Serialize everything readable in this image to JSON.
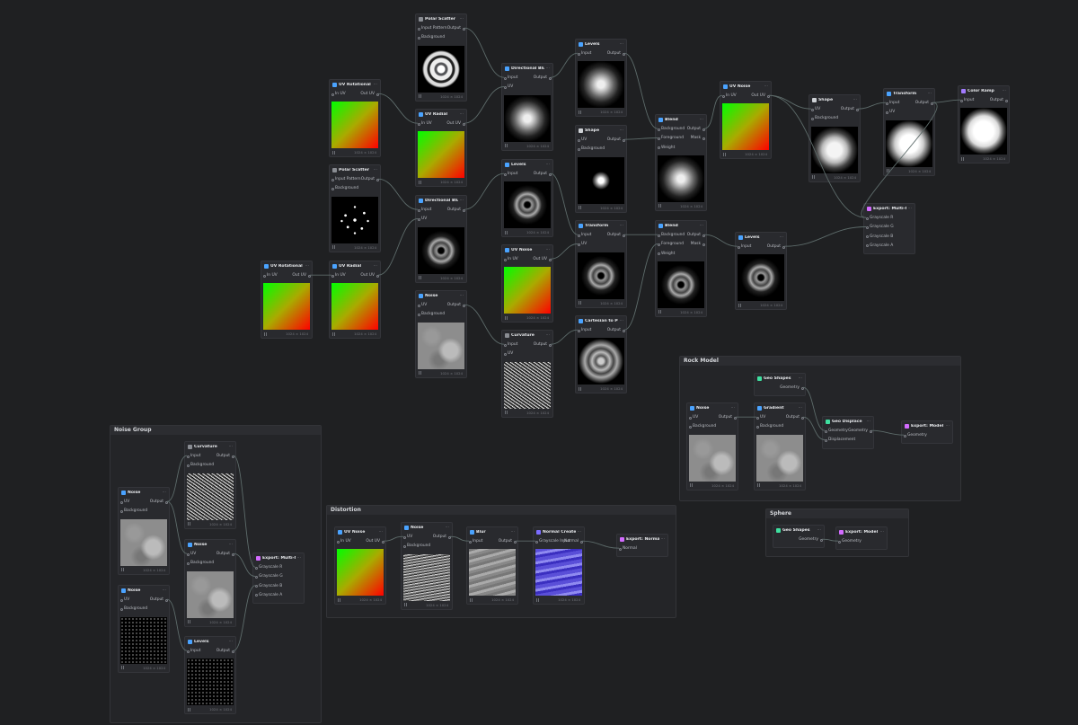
{
  "groups": [
    {
      "key": "noise_group",
      "title": "Noise Group"
    },
    {
      "key": "distortion",
      "title": "Distortion"
    },
    {
      "key": "rock_model",
      "title": "Rock Model"
    },
    {
      "key": "sphere",
      "title": "Sphere"
    }
  ],
  "nodes": [
    {
      "key": "polar_scatter_1",
      "title": "Polar Scatter",
      "icon_color": "#8a8d93",
      "inputs": [
        "Input Pattern",
        "Background"
      ],
      "outputs": [
        "Output"
      ],
      "preview": "pv-radial",
      "res": "1024 × 1024"
    },
    {
      "key": "uv_rotational_1",
      "title": "UV Rotational",
      "icon_color": "#4aa3ff",
      "inputs": [
        "In UV"
      ],
      "outputs": [
        "Out UV"
      ],
      "preview": "pv-uv2",
      "res": "1024 × 1024"
    },
    {
      "key": "uv_radial_1",
      "title": "UV Radial",
      "icon_color": "#4aa3ff",
      "inputs": [
        "In UV"
      ],
      "outputs": [
        "Out UV"
      ],
      "preview": "pv-uv2",
      "res": "1024 × 1024"
    },
    {
      "key": "directional_blur_1",
      "title": "Directional Blur",
      "icon_color": "#4aa3ff",
      "inputs": [
        "Input",
        "UV"
      ],
      "outputs": [
        "Output"
      ],
      "preview": "pv-swirl-soft",
      "res": "1024 × 1024"
    },
    {
      "key": "levels_1",
      "title": "Levels",
      "icon_color": "#4aa3ff",
      "inputs": [
        "Input"
      ],
      "outputs": [
        "Output"
      ],
      "preview": "pv-swirl-soft",
      "res": "1024 × 1024"
    },
    {
      "key": "shape_1",
      "title": "Shape",
      "icon_color": "#cfd2d6",
      "inputs": [
        "UV",
        "Background"
      ],
      "outputs": [
        "Output"
      ],
      "preview": "pv-dot",
      "res": "1024 × 1024"
    },
    {
      "key": "blend_1",
      "title": "Blend",
      "icon_color": "#4aa3ff",
      "inputs": [
        "Background",
        "Foreground",
        "Weight"
      ],
      "outputs": [
        "Output",
        "Mask"
      ],
      "preview": "pv-swirl-soft",
      "res": "1024 × 1024"
    },
    {
      "key": "uv_noise_1",
      "title": "UV Noise",
      "icon_color": "#4aa3ff",
      "inputs": [
        "In UV"
      ],
      "outputs": [
        "Out UV"
      ],
      "preview": "pv-uv2",
      "res": "1024 × 1024"
    },
    {
      "key": "shape_2",
      "title": "Shape",
      "icon_color": "#cfd2d6",
      "inputs": [
        "UV",
        "Background"
      ],
      "outputs": [
        "Output"
      ],
      "preview": "pv-blob",
      "res": "1024 × 1024"
    },
    {
      "key": "transform_1",
      "title": "Transform",
      "icon_color": "#4aa3ff",
      "inputs": [
        "Input",
        "UV"
      ],
      "outputs": [
        "Output"
      ],
      "preview": "pv-cloud",
      "res": "1024 × 1024"
    },
    {
      "key": "color_ramp",
      "title": "Color Ramp",
      "icon_color": "#a27bff",
      "inputs": [
        "Input"
      ],
      "outputs": [
        "Output"
      ],
      "preview": "pv-ramp",
      "res": "1024 × 1024"
    },
    {
      "key": "polar_scatter_2",
      "title": "Polar Scatter",
      "icon_color": "#8a8d93",
      "inputs": [
        "Input Pattern",
        "Background"
      ],
      "outputs": [
        "Output"
      ],
      "preview": "pv-sparks",
      "res": "1024 × 1024"
    },
    {
      "key": "directional_blur_2",
      "title": "Directional Blur",
      "icon_color": "#4aa3ff",
      "inputs": [
        "Input",
        "UV"
      ],
      "outputs": [
        "Output"
      ],
      "preview": "pv-swirl",
      "res": "1024 × 1024"
    },
    {
      "key": "levels_2",
      "title": "Levels",
      "icon_color": "#4aa3ff",
      "inputs": [
        "Input"
      ],
      "outputs": [
        "Output"
      ],
      "preview": "pv-swirl",
      "res": "1024 × 1024"
    },
    {
      "key": "transform_2",
      "title": "Transform",
      "icon_color": "#4aa3ff",
      "inputs": [
        "Input",
        "UV"
      ],
      "outputs": [
        "Output"
      ],
      "preview": "pv-swirl",
      "res": "1024 × 1024"
    },
    {
      "key": "blend_2",
      "title": "Blend",
      "icon_color": "#4aa3ff",
      "inputs": [
        "Background",
        "Foreground",
        "Weight"
      ],
      "outputs": [
        "Output",
        "Mask"
      ],
      "preview": "pv-swirl",
      "res": "1024 × 1024"
    },
    {
      "key": "levels_3",
      "title": "Levels",
      "icon_color": "#4aa3ff",
      "inputs": [
        "Input"
      ],
      "outputs": [
        "Output"
      ],
      "preview": "pv-swirl",
      "res": "1024 × 1024"
    },
    {
      "key": "export_multi_mask_1",
      "title": "Export: Multi-Mask",
      "icon_color": "#d36bff",
      "inputs": [
        "Grayscale R",
        "Grayscale G",
        "Grayscale B",
        "Grayscale A"
      ],
      "outputs": [],
      "preview": null
    },
    {
      "key": "uv_rotational_2",
      "title": "UV Rotational",
      "icon_color": "#4aa3ff",
      "inputs": [
        "In UV"
      ],
      "outputs": [
        "Out UV"
      ],
      "preview": "pv-uv2",
      "res": "1024 × 1024"
    },
    {
      "key": "uv_radial_2",
      "title": "UV Radial",
      "icon_color": "#4aa3ff",
      "inputs": [
        "In UV"
      ],
      "outputs": [
        "Out UV"
      ],
      "preview": "pv-uv2",
      "res": "1024 × 1024"
    },
    {
      "key": "uv_noise_2",
      "title": "UV Noise",
      "icon_color": "#4aa3ff",
      "inputs": [
        "In UV"
      ],
      "outputs": [
        "Out UV"
      ],
      "preview": "pv-uv2",
      "res": "1024 × 1024"
    },
    {
      "key": "noise_1",
      "title": "Noise",
      "icon_color": "#4aa3ff",
      "inputs": [
        "UV",
        "Background"
      ],
      "outputs": [
        "Output"
      ],
      "preview": "pv-noise",
      "res": "1024 × 1024"
    },
    {
      "key": "curvature_1",
      "title": "Curvature",
      "icon_color": "#8a8d93",
      "inputs": [
        "Input",
        "UV"
      ],
      "outputs": [
        "Output"
      ],
      "preview": "pv-curv",
      "res": "1024 × 1024"
    },
    {
      "key": "cartesian_polar",
      "title": "Cartesian to Polar",
      "icon_color": "#4aa3ff",
      "inputs": [
        "Input"
      ],
      "outputs": [
        "Output"
      ],
      "preview": "pv-polar",
      "res": "1024 × 1024"
    },
    {
      "key": "ng_noise_1",
      "title": "Noise",
      "icon_color": "#4aa3ff",
      "inputs": [
        "UV",
        "Background"
      ],
      "outputs": [
        "Output"
      ],
      "preview": "pv-noise",
      "res": "1024 × 1024"
    },
    {
      "key": "ng_curvature",
      "title": "Curvature",
      "icon_color": "#8a8d93",
      "inputs": [
        "Input",
        "Background"
      ],
      "outputs": [
        "Output"
      ],
      "preview": "pv-curv",
      "res": "1024 × 1024"
    },
    {
      "key": "ng_noise_2",
      "title": "Noise",
      "icon_color": "#4aa3ff",
      "inputs": [
        "UV",
        "Background"
      ],
      "outputs": [
        "Output"
      ],
      "preview": "pv-noise",
      "res": "1024 × 1024"
    },
    {
      "key": "ng_export",
      "title": "Export: Multi-Mask",
      "icon_color": "#d36bff",
      "inputs": [
        "Grayscale R",
        "Grayscale G",
        "Grayscale B",
        "Grayscale A"
      ],
      "outputs": [],
      "preview": null
    },
    {
      "key": "ng_noise_3",
      "title": "Noise",
      "icon_color": "#4aa3ff",
      "inputs": [
        "UV",
        "Background"
      ],
      "outputs": [
        "Output"
      ],
      "preview": "pv-dots",
      "res": "1024 × 1024"
    },
    {
      "key": "ng_levels",
      "title": "Levels",
      "icon_color": "#4aa3ff",
      "inputs": [
        "Input"
      ],
      "outputs": [
        "Output"
      ],
      "preview": "pv-dots",
      "res": "1024 × 1024"
    },
    {
      "key": "d_uv_noise",
      "title": "UV Noise",
      "icon_color": "#4aa3ff",
      "inputs": [
        "In UV"
      ],
      "outputs": [
        "Out UV"
      ],
      "preview": "pv-uv2",
      "res": "1024 × 1024"
    },
    {
      "key": "d_noise",
      "title": "Noise",
      "icon_color": "#4aa3ff",
      "inputs": [
        "UV",
        "Background"
      ],
      "outputs": [
        "Output"
      ],
      "preview": "pv-wave",
      "res": "1024 × 1024"
    },
    {
      "key": "d_blur",
      "title": "Blur",
      "icon_color": "#4aa3ff",
      "inputs": [
        "Input"
      ],
      "outputs": [
        "Output"
      ],
      "preview": "pv-blur",
      "res": "1024 × 1024"
    },
    {
      "key": "d_normal",
      "title": "Normal Create",
      "icon_color": "#7b6cff",
      "inputs": [
        "Grayscale Input"
      ],
      "outputs": [
        "Normal"
      ],
      "preview": "pv-normal",
      "res": "1024 × 1024"
    },
    {
      "key": "d_export",
      "title": "Export: Normal",
      "icon_color": "#d36bff",
      "inputs": [
        "Normal"
      ],
      "outputs": [],
      "preview": null
    },
    {
      "key": "r_geo_shapes",
      "title": "Geo Shapes",
      "icon_color": "#3fe0a0",
      "inputs": [],
      "outputs": [
        "Geometry"
      ],
      "preview": null
    },
    {
      "key": "r_noise",
      "title": "Noise",
      "icon_color": "#4aa3ff",
      "inputs": [
        "UV",
        "Background"
      ],
      "outputs": [
        "Output"
      ],
      "preview": "pv-noise",
      "res": "1024 × 1024"
    },
    {
      "key": "r_gradient",
      "title": "Gradient",
      "icon_color": "#4aa3ff",
      "inputs": [
        "UV",
        "Background"
      ],
      "outputs": [
        "Output"
      ],
      "preview": "pv-noise",
      "res": "1024 × 1024"
    },
    {
      "key": "r_geo_displace",
      "title": "Geo Displace",
      "icon_color": "#3fe0a0",
      "inputs": [
        "Geometry",
        "Displacement"
      ],
      "outputs": [
        "Geometry"
      ],
      "preview": null
    },
    {
      "key": "r_export",
      "title": "Export: Model",
      "icon_color": "#d36bff",
      "inputs": [
        "Geometry"
      ],
      "outputs": [],
      "preview": null
    },
    {
      "key": "s_geo_shapes",
      "title": "Geo Shapes",
      "icon_color": "#3fe0a0",
      "inputs": [],
      "outputs": [
        "Geometry"
      ],
      "preview": null
    },
    {
      "key": "s_export",
      "title": "Export: Model",
      "icon_color": "#d36bff",
      "inputs": [
        "Geometry"
      ],
      "outputs": [],
      "preview": null
    }
  ]
}
